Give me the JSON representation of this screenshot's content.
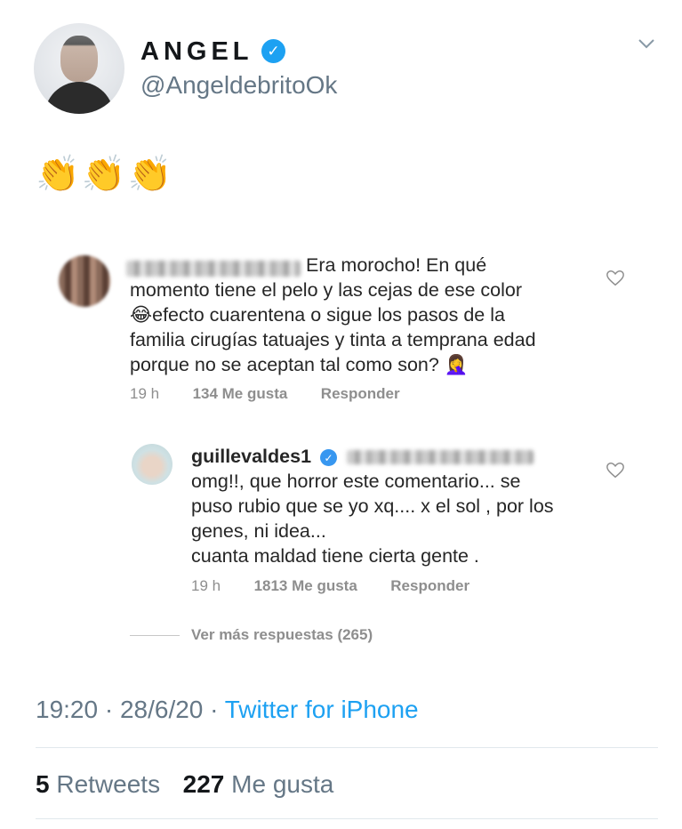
{
  "tweet": {
    "author": {
      "display_name": "ANGEL",
      "handle": "@AngeldebritoOk",
      "verified": true
    },
    "text": "👏👏👏",
    "menu_icon": "chevron-down-icon",
    "timestamp": "19:20 · 28/6/20 · ",
    "source": "Twitter for iPhone",
    "retweets_count": "5",
    "retweets_label": "Retweets",
    "likes_count": "227",
    "likes_label": "Me gusta",
    "accent_color": "#1da1f2"
  },
  "instagram": {
    "comment": {
      "text_lines": [
        "Era morocho! En qué",
        "momento tiene el pelo y las cejas de ese color",
        "😂efecto cuarentena o sigue los pasos de la",
        "familia cirugías tatuajes y tinta a temprana edad",
        "porque no se aceptan tal como son? 🤦‍♀️"
      ],
      "time": "19 h",
      "likes": "134 Me gusta",
      "reply_label": "Responder"
    },
    "reply": {
      "username": "guillevaldes1",
      "verified": true,
      "text_lines": [
        "omg!!, que horror este comentario... se",
        "puso rubio que se yo xq.... x el sol , por los",
        "genes, ni idea...",
        "cuanta maldad tiene cierta gente ."
      ],
      "time": "19 h",
      "likes": "1813 Me gusta",
      "reply_label": "Responder"
    },
    "more_replies": "Ver más respuestas (265)"
  }
}
